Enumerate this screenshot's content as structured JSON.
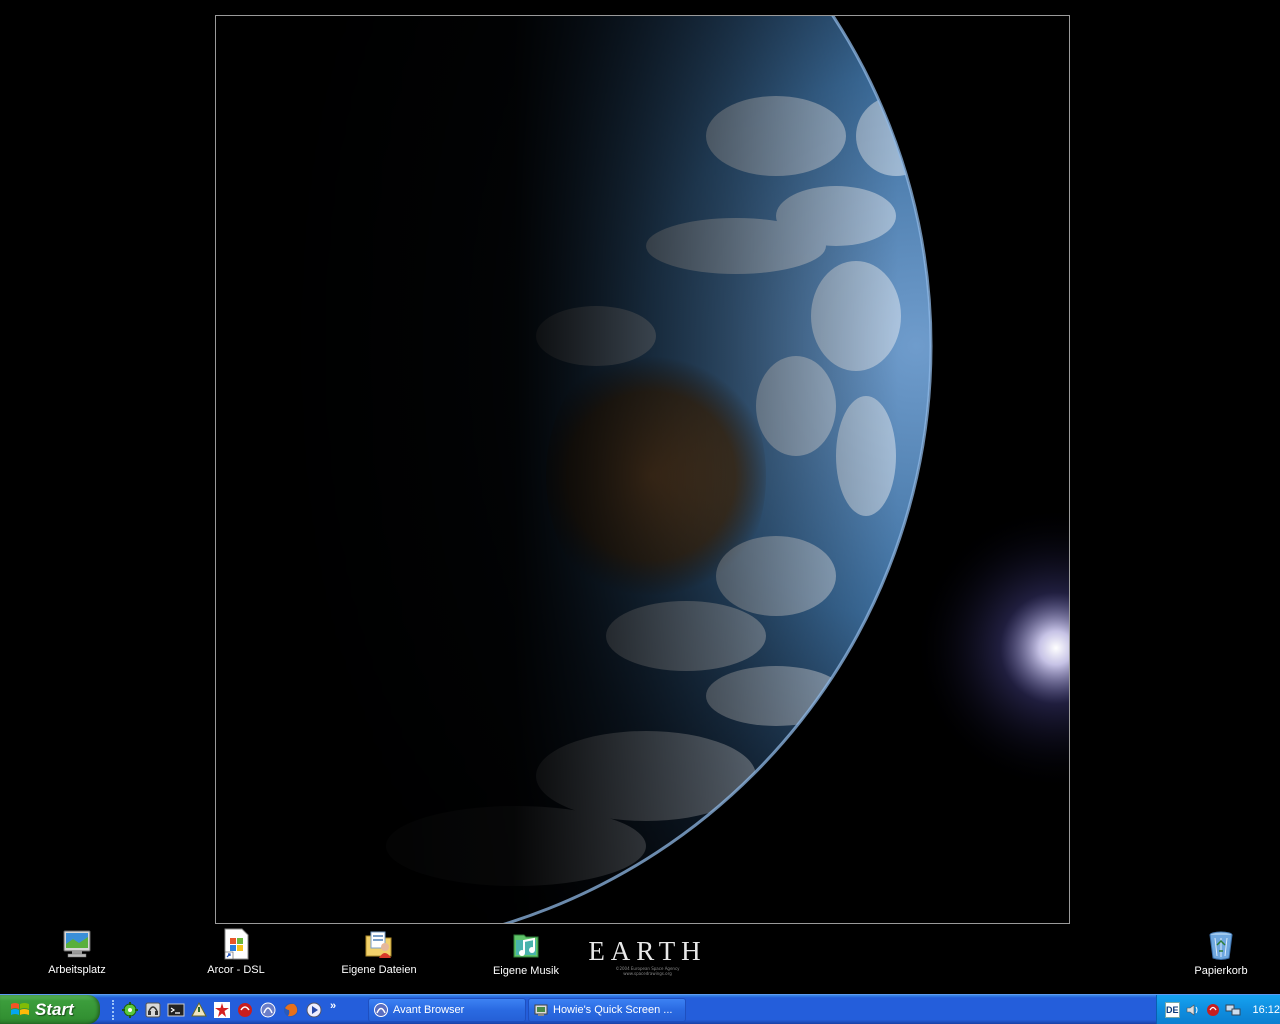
{
  "desktop": {
    "icons": [
      {
        "label": "Arbeitsplatz",
        "icon": "my-computer-icon"
      },
      {
        "label": "Arcor - DSL",
        "icon": "arcor-shortcut-icon"
      },
      {
        "label": "Eigene Dateien",
        "icon": "my-documents-icon"
      },
      {
        "label": "Eigene Musik",
        "icon": "my-music-icon"
      },
      {
        "label": "Papierkorb",
        "icon": "recycle-bin-icon"
      }
    ],
    "wallpaper": {
      "title": "EARTH",
      "credit_line1": "©2004 European Space Agency",
      "credit_line2": "www.spacedrawings.org"
    }
  },
  "taskbar": {
    "start_label": "Start",
    "quicklaunch_icons": [
      "settings-icon",
      "headset-icon",
      "terminal-icon",
      "network-icon",
      "shield-icon",
      "app-icon",
      "browser-icon",
      "firefox-icon",
      "media-player-icon"
    ],
    "quicklaunch_more": "»",
    "tasks": [
      {
        "label": "Avant Browser",
        "icon": "avant-browser-icon"
      },
      {
        "label": "Howie's Quick Screen ...",
        "icon": "screen-capture-icon"
      }
    ],
    "tray": {
      "language": "DE",
      "time": "16:12"
    }
  },
  "colors": {
    "taskbar_blue": "#245edb",
    "start_green": "#3c9d3c",
    "tray_blue": "#0f8ee0"
  }
}
